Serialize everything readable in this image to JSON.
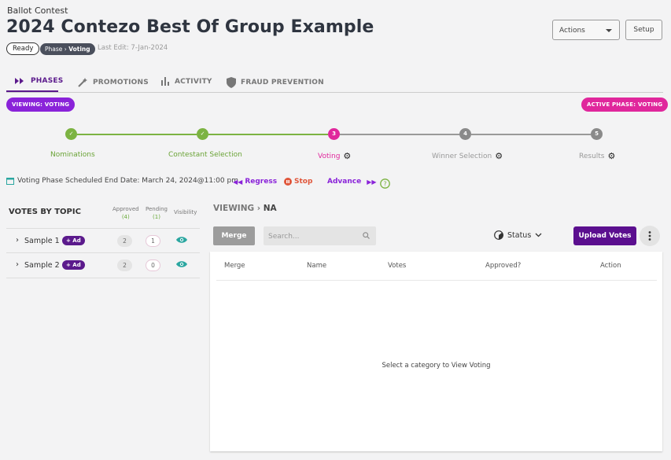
{
  "header": {
    "kicker": "Ballot Contest",
    "title": "2024 Contezo Best Of Group Example",
    "status_pill": "Ready",
    "phase_prefix": "Phase",
    "phase_current": "Voting",
    "last_edit": "Last Edit: 7-Jan-2024",
    "actions_label": "Actions",
    "setup_label": "Setup"
  },
  "tabs": [
    {
      "label": "PHASES",
      "icon": "double-chevron-icon",
      "active": true
    },
    {
      "label": "PROMOTIONS",
      "icon": "magic-wand-icon",
      "active": false
    },
    {
      "label": "ACTIVITY",
      "icon": "bar-chart-icon",
      "active": false
    },
    {
      "label": "FRAUD PREVENTION",
      "icon": "shield-icon",
      "active": false
    }
  ],
  "viewing_pill": "VIEWING:  VOTING",
  "active_phase_pill": "ACTIVE PHASE:  VOTING",
  "steps": [
    {
      "label": "Nominations",
      "state": "done",
      "marker": "✓"
    },
    {
      "label": "Contestant Selection",
      "state": "done",
      "marker": "✓"
    },
    {
      "label": "Voting",
      "state": "current",
      "marker": "3"
    },
    {
      "label": "Winner Selection",
      "state": "upcoming",
      "marker": "4"
    },
    {
      "label": "Results",
      "state": "upcoming",
      "marker": "5"
    }
  ],
  "schedule": {
    "text": "Voting Phase Scheduled End Date: March 24, 2024@11:00 pm",
    "regress": "Regress",
    "stop": "Stop",
    "advance": "Advance"
  },
  "votes_by_topic": {
    "title": "VOTES BY TOPIC",
    "col_approved": "Approved",
    "col_approved_count": "(4)",
    "col_pending": "Pending",
    "col_pending_count": "(1)",
    "col_visibility": "Visibility",
    "rows": [
      {
        "name": "Sample 1",
        "badge": "+ Ad",
        "approved": "2",
        "pending": "1"
      },
      {
        "name": "Sample 2",
        "badge": "+ Ad",
        "approved": "2",
        "pending": "0"
      }
    ]
  },
  "main": {
    "crumb_root": "VIEWING",
    "crumb_leaf": "NA",
    "merge_label": "Merge",
    "search_placeholder": "Search...",
    "status_label": "Status",
    "upload_label": "Upload Votes",
    "columns": [
      "Merge",
      "Name",
      "Votes",
      "Approved?",
      "Action"
    ],
    "empty_text": "Select a category to View Voting"
  },
  "colors": {
    "primary": "#5b1a8c",
    "viewing": "#8a23d9",
    "active_phase": "#e0279c",
    "done": "#7cb342",
    "upcoming": "#8a8a8a",
    "teal_eye": "#2aa6a0"
  }
}
